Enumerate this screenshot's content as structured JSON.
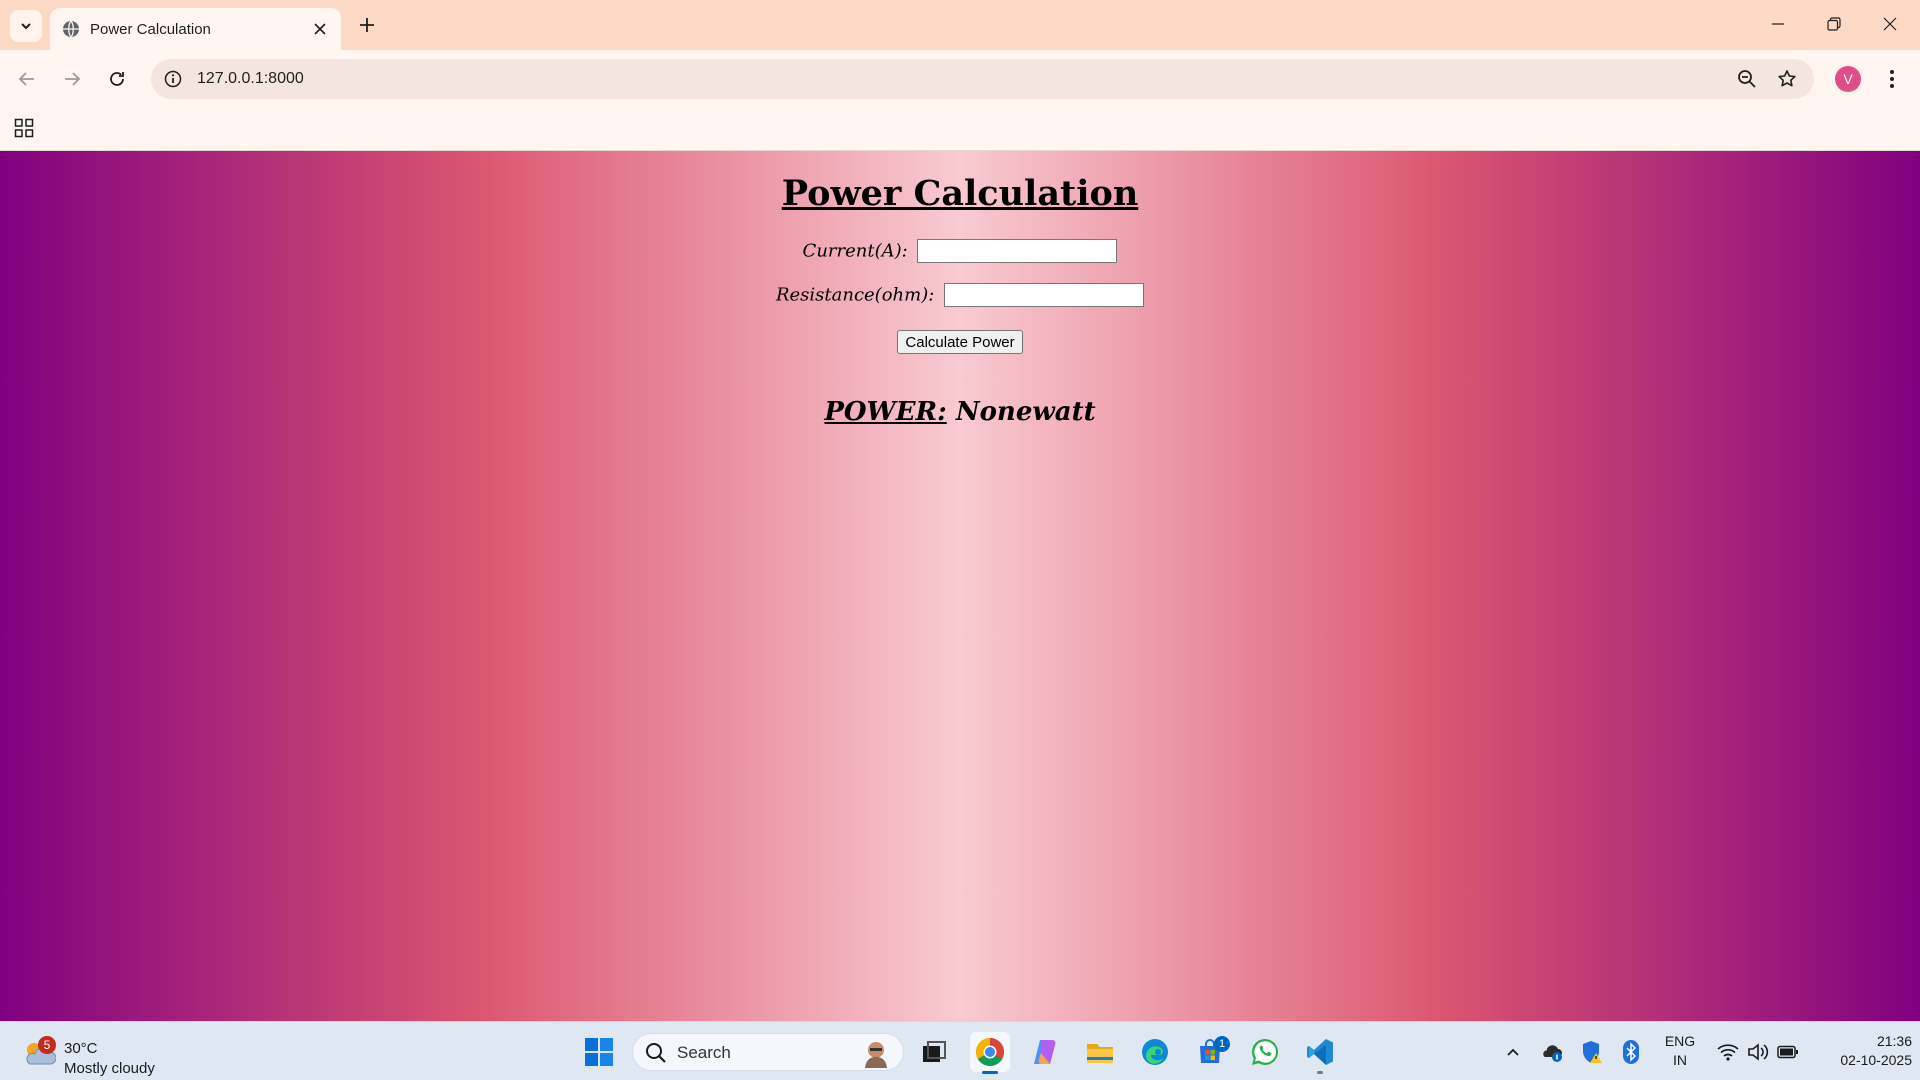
{
  "browser": {
    "tab_title": "Power Calculation",
    "url": "127.0.0.1:8000",
    "profile_initial": "V"
  },
  "page": {
    "heading": "Power Calculation",
    "current_label": "Current(A):",
    "current_value": "",
    "resistance_label": "Resistance(ohm):",
    "resistance_value": "",
    "button_label": "Calculate Power",
    "result_label": "POWER:",
    "result_value": "Nonewatt",
    "gradient_colors": [
      "#800080",
      "#db5670",
      "#f8cad1"
    ]
  },
  "taskbar": {
    "weather_badge": "5",
    "temperature": "30°C",
    "condition": "Mostly cloudy",
    "search_placeholder": "Search",
    "store_badge": "1",
    "lang_line1": "ENG",
    "lang_line2": "IN",
    "time": "21:36",
    "date": "02-10-2025",
    "apps": [
      "windows-start-icon",
      "search",
      "task-view-icon",
      "chrome-icon",
      "copilot-icon",
      "file-explorer-icon",
      "edge-icon",
      "store-icon",
      "whatsapp-icon",
      "vscode-icon"
    ]
  }
}
